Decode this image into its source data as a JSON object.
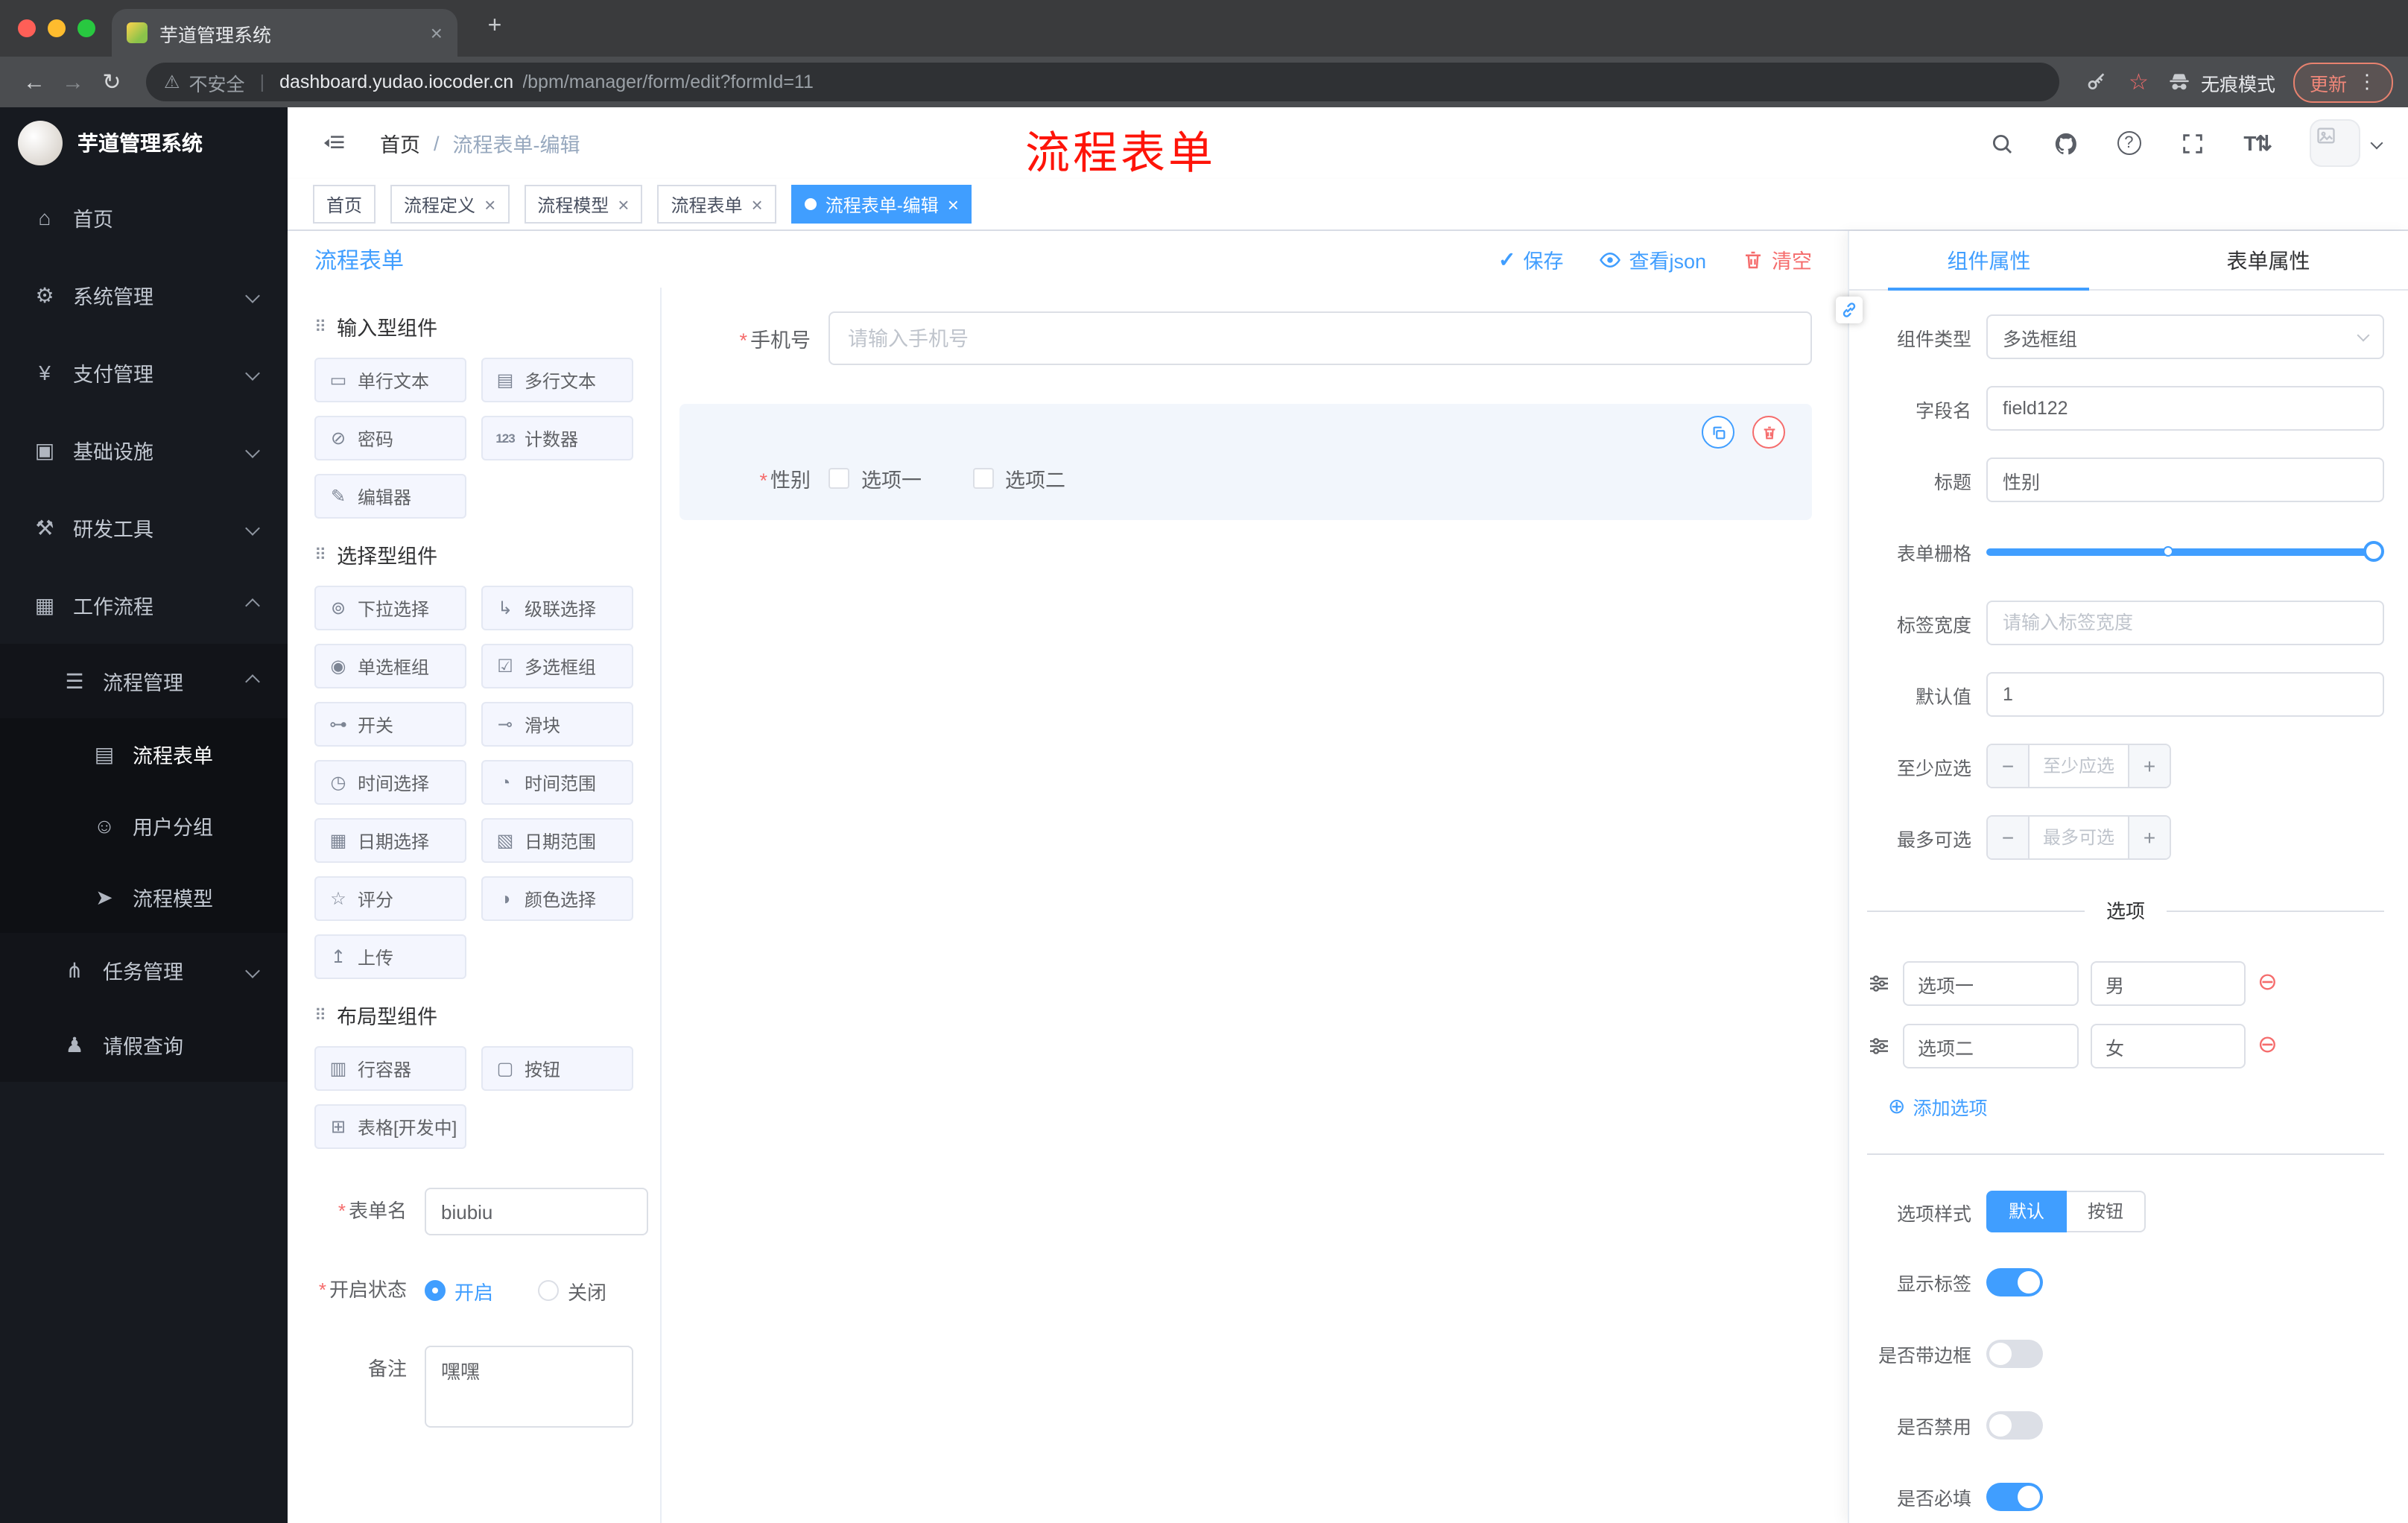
{
  "colors": {
    "primary": "#409eff",
    "danger": "#f56c6c"
  },
  "icons": {
    "back": "←",
    "forward": "→",
    "reload": "↻",
    "warning": "⚠",
    "star": "☆",
    "menu_dots": "⋮",
    "close": "×",
    "plus": "+",
    "pipe": "|",
    "slash": "/",
    "help": "?",
    "text_size": "T⇅",
    "check": "✓",
    "section_drag": "⠿",
    "minus_step": "−",
    "plus_step": "+",
    "remove_circle": "⊖",
    "add_circle": "⊕"
  },
  "misc": {
    "required": "*"
  },
  "browser": {
    "tab_title": "芋道管理系统",
    "security_label": "不安全",
    "url_domain": "dashboard.yudao.iocoder.cn",
    "url_path": "/bpm/manager/form/edit?formId=11",
    "incognito_label": "无痕模式",
    "update_label": "更新"
  },
  "sidebar": {
    "app_title": "芋道管理系统",
    "items": [
      {
        "label": "首页",
        "icon_glyph": "⌂"
      },
      {
        "label": "系统管理",
        "icon_glyph": "⚙"
      },
      {
        "label": "支付管理",
        "icon_glyph": "¥"
      },
      {
        "label": "基础设施",
        "icon_glyph": "▣"
      },
      {
        "label": "研发工具",
        "icon_glyph": "⚒"
      },
      {
        "label": "工作流程",
        "icon_glyph": "▦"
      },
      {
        "label": "流程管理",
        "icon_glyph": "☰"
      },
      {
        "label": "流程表单",
        "icon_glyph": "▤"
      },
      {
        "label": "用户分组",
        "icon_glyph": "☺"
      },
      {
        "label": "流程模型",
        "icon_glyph": "➤"
      },
      {
        "label": "任务管理",
        "icon_glyph": "⋔"
      },
      {
        "label": "请假查询",
        "icon_glyph": "♟"
      }
    ]
  },
  "header": {
    "breadcrumb_home": "首页",
    "breadcrumb_current": "流程表单-编辑",
    "annotation": "流程表单"
  },
  "tags": [
    {
      "label": "首页"
    },
    {
      "label": "流程定义"
    },
    {
      "label": "流程模型"
    },
    {
      "label": "流程表单"
    },
    {
      "label": "流程表单-编辑"
    }
  ],
  "page": {
    "title": "流程表单",
    "save": "保存",
    "view_json": "查看json",
    "clear": "清空"
  },
  "palette": {
    "sections": [
      {
        "title": "输入型组件",
        "items": [
          {
            "label": "单行文本",
            "glyph": "▭"
          },
          {
            "label": "多行文本",
            "glyph": "▤"
          },
          {
            "label": "密码",
            "glyph": "⊘"
          },
          {
            "label": "计数器",
            "glyph": "123"
          },
          {
            "label": "编辑器",
            "glyph": "✎"
          }
        ]
      },
      {
        "title": "选择型组件",
        "items": [
          {
            "label": "下拉选择",
            "glyph": "⊚"
          },
          {
            "label": "级联选择",
            "glyph": "↳"
          },
          {
            "label": "单选框组",
            "glyph": "◉"
          },
          {
            "label": "多选框组",
            "glyph": "☑"
          },
          {
            "label": "开关",
            "glyph": "⊶"
          },
          {
            "label": "滑块",
            "glyph": "⊸"
          },
          {
            "label": "时间选择",
            "glyph": "◷"
          },
          {
            "label": "时间范围",
            "glyph": "◔"
          },
          {
            "label": "日期选择",
            "glyph": "▦"
          },
          {
            "label": "日期范围",
            "glyph": "▧"
          },
          {
            "label": "评分",
            "glyph": "☆"
          },
          {
            "label": "颜色选择",
            "glyph": "◑"
          },
          {
            "label": "上传",
            "glyph": "↥"
          }
        ]
      },
      {
        "title": "布局型组件",
        "items": [
          {
            "label": "行容器",
            "glyph": "▥"
          },
          {
            "label": "按钮",
            "glyph": "▢"
          },
          {
            "label": "表格[开发中]",
            "glyph": "⊞"
          }
        ]
      }
    ],
    "form": {
      "name_label": "表单名",
      "name_value": "biubiu",
      "status_label": "开启状态",
      "status_on": "开启",
      "status_off": "关闭",
      "remark_label": "备注",
      "remark_value": "嘿嘿"
    }
  },
  "canvas": {
    "phone_label": "手机号",
    "phone_placeholder": "请输入手机号",
    "gender_label": "性别",
    "gender_option1": "选项一",
    "gender_option2": "选项二"
  },
  "props": {
    "tab_component": "组件属性",
    "tab_form": "表单属性",
    "type_label": "组件类型",
    "type_value": "多选框组",
    "field_label": "字段名",
    "field_value": "field122",
    "title_label": "标题",
    "title_value": "性别",
    "grid_label": "表单栅格",
    "label_width_label": "标签宽度",
    "label_width_placeholder": "请输入标签宽度",
    "default_label": "默认值",
    "default_value": "1",
    "min_label": "至少应选",
    "min_placeholder": "至少应选",
    "max_label": "最多可选",
    "max_placeholder": "最多可选",
    "options_divider": "选项",
    "options": [
      {
        "label": "选项一",
        "value": "男"
      },
      {
        "label": "选项二",
        "value": "女"
      }
    ],
    "add_option": "添加选项",
    "style_label": "选项样式",
    "style_default": "默认",
    "style_button": "按钮",
    "switch_show_label": "显示标签",
    "switch_border": "是否带边框",
    "switch_disabled": "是否禁用",
    "switch_required": "是否必填"
  }
}
